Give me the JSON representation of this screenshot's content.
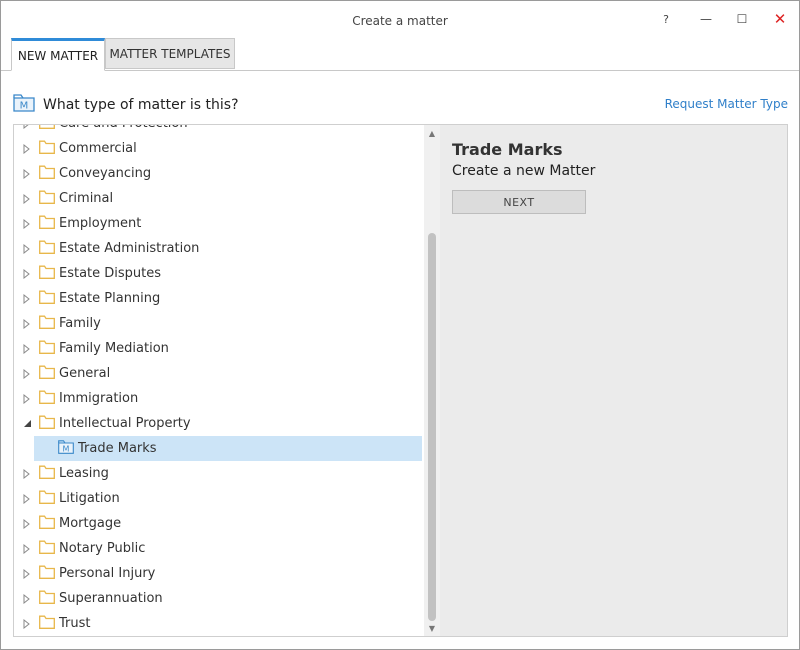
{
  "window": {
    "title": "Create a matter",
    "controls": {
      "help": "?",
      "minimize": "—",
      "maximize": "☐",
      "close": "✕"
    }
  },
  "tabs": [
    {
      "label": "NEW MATTER",
      "active": true
    },
    {
      "label": "MATTER TEMPLATES",
      "active": false
    }
  ],
  "heading": {
    "text": "What type of matter is this?",
    "icon": "matter-icon"
  },
  "request_link": "Request Matter Type",
  "tree": {
    "items": [
      {
        "label": "Care and Protection",
        "expanded": false
      },
      {
        "label": "Commercial",
        "expanded": false
      },
      {
        "label": "Conveyancing",
        "expanded": false
      },
      {
        "label": "Criminal",
        "expanded": false
      },
      {
        "label": "Employment",
        "expanded": false
      },
      {
        "label": "Estate Administration",
        "expanded": false
      },
      {
        "label": "Estate Disputes",
        "expanded": false
      },
      {
        "label": "Estate Planning",
        "expanded": false
      },
      {
        "label": "Family",
        "expanded": false
      },
      {
        "label": "Family Mediation",
        "expanded": false
      },
      {
        "label": "General",
        "expanded": false
      },
      {
        "label": "Immigration",
        "expanded": false
      },
      {
        "label": "Intellectual Property",
        "expanded": true
      },
      {
        "label": "Trade Marks",
        "child": true,
        "selected": true
      },
      {
        "label": "Leasing",
        "expanded": false
      },
      {
        "label": "Litigation",
        "expanded": false
      },
      {
        "label": "Mortgage",
        "expanded": false
      },
      {
        "label": "Notary Public",
        "expanded": false
      },
      {
        "label": "Personal Injury",
        "expanded": false
      },
      {
        "label": "Superannuation",
        "expanded": false
      },
      {
        "label": "Trust",
        "expanded": false
      }
    ]
  },
  "detail": {
    "title": "Trade Marks",
    "subtitle": "Create a new Matter",
    "next_label": "NEXT"
  },
  "colors": {
    "accent": "#2f8bd8",
    "selection": "#cce4f7",
    "folder": "#e8b74a",
    "link": "#2f7fc9"
  }
}
